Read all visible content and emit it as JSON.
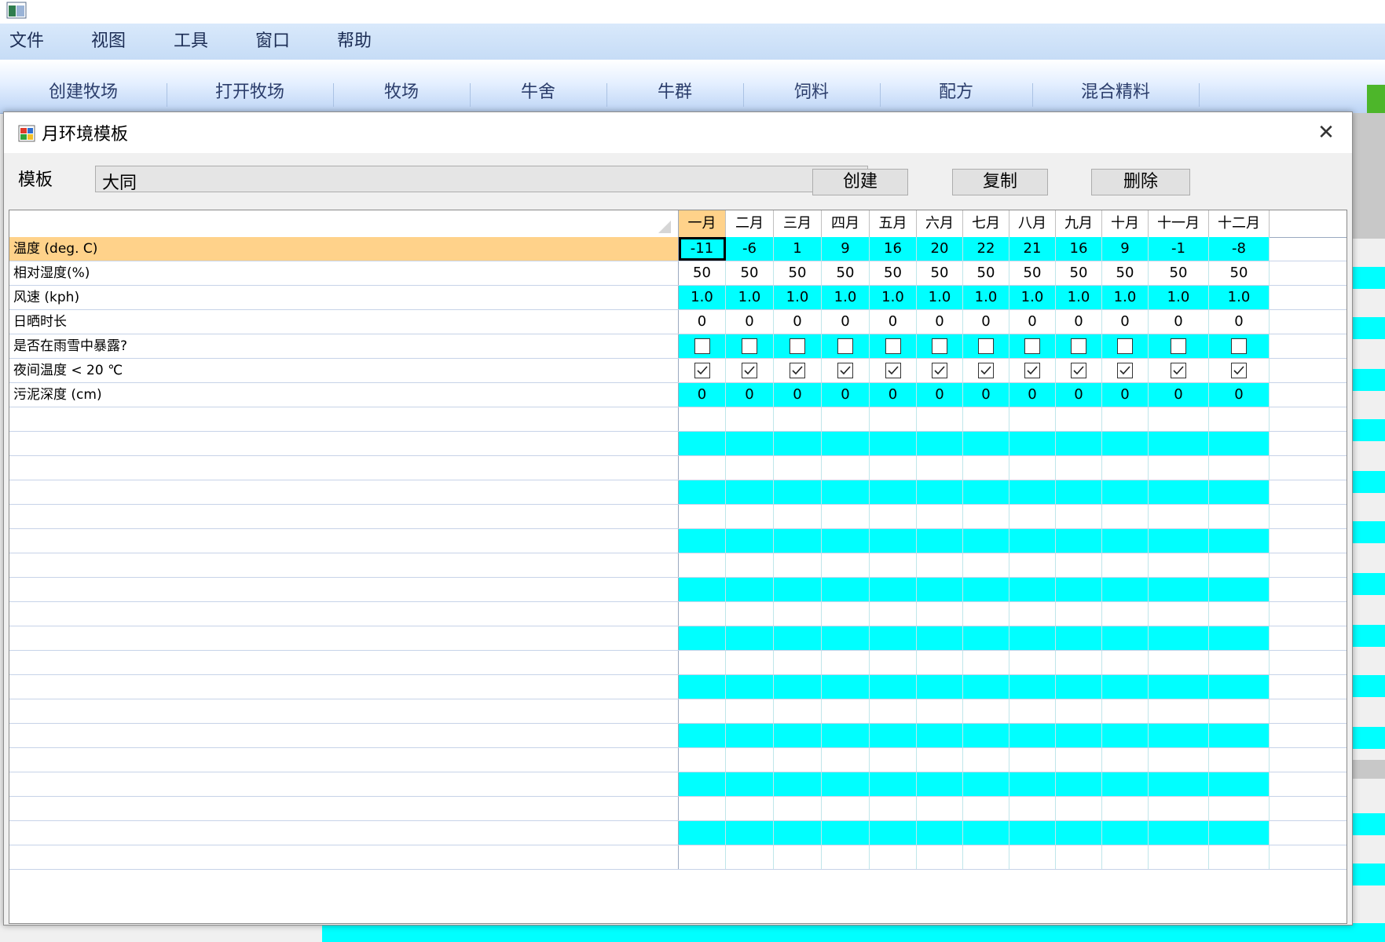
{
  "menubar": {
    "items": [
      "文件",
      "视图",
      "工具",
      "窗口",
      "帮助"
    ]
  },
  "toolbar": {
    "items": [
      "创建牧场",
      "打开牧场",
      "牧场",
      "牛舍",
      "牛群",
      "饲料",
      "配方",
      "混合精料"
    ]
  },
  "dialog": {
    "title": "月环境模板",
    "close_glyph": "✕",
    "template_label": "模板",
    "template_value": "大同",
    "create_button": "创建",
    "copy_button": "复制",
    "delete_button": "删除"
  },
  "grid": {
    "months": [
      "一月",
      "二月",
      "三月",
      "四月",
      "五月",
      "六月",
      "七月",
      "八月",
      "九月",
      "十月",
      "十一月",
      "十二月"
    ],
    "rows": [
      {
        "label": "温度 (deg. C)",
        "type": "text",
        "values": [
          "-11",
          "-6",
          "1",
          "9",
          "16",
          "20",
          "22",
          "21",
          "16",
          "9",
          "-1",
          "-8"
        ]
      },
      {
        "label": "相对湿度(%)",
        "type": "text",
        "values": [
          "50",
          "50",
          "50",
          "50",
          "50",
          "50",
          "50",
          "50",
          "50",
          "50",
          "50",
          "50"
        ]
      },
      {
        "label": "风速 (kph)",
        "type": "text",
        "values": [
          "1.0",
          "1.0",
          "1.0",
          "1.0",
          "1.0",
          "1.0",
          "1.0",
          "1.0",
          "1.0",
          "1.0",
          "1.0",
          "1.0"
        ]
      },
      {
        "label": "日晒时长",
        "type": "text",
        "values": [
          "0",
          "0",
          "0",
          "0",
          "0",
          "0",
          "0",
          "0",
          "0",
          "0",
          "0",
          "0"
        ]
      },
      {
        "label": "是否在雨雪中暴露?",
        "type": "check",
        "values": [
          false,
          false,
          false,
          false,
          false,
          false,
          false,
          false,
          false,
          false,
          false,
          false
        ]
      },
      {
        "label": "夜间温度 < 20 ℃",
        "type": "check",
        "values": [
          true,
          true,
          true,
          true,
          true,
          true,
          true,
          true,
          true,
          true,
          true,
          true
        ]
      },
      {
        "label": "污泥深度 (cm)",
        "type": "text",
        "values": [
          "0",
          "0",
          "0",
          "0",
          "0",
          "0",
          "0",
          "0",
          "0",
          "0",
          "0",
          "0"
        ]
      }
    ],
    "colors": {
      "odd_row": "#00ffff",
      "selected_row": "#ffd28a",
      "even_row": "#ffffff"
    }
  }
}
